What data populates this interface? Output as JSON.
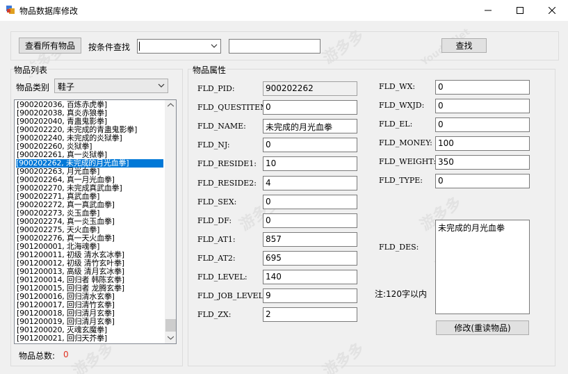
{
  "window": {
    "title": "物品数据库修改"
  },
  "toolbar": {
    "view_all_label": "查看所有物品",
    "condition_label": "按条件查找",
    "condition_value": "",
    "search_value": "",
    "search_label": "查找"
  },
  "item_list": {
    "title": "物品列表",
    "category_label": "物品类别",
    "category_value": "鞋子",
    "items": [
      "[900202036, 百炼赤虎拳]",
      "[900202038, 真炎赤狼拳]",
      "[900202040, 青蛊鬼影拳]",
      "[900202220, 未完成的青蛊鬼影拳]",
      "[900202240, 未完成的炎狱拳]",
      "[900202260, 炎狱拳]",
      "[900202261, 真一炎狱拳]",
      "[900202262, 未完成的月光血拳]",
      "[900202263, 月光血拳]",
      "[900202264, 真一月光血拳]",
      "[900202270, 未完成真武血拳]",
      "[900202271, 真武血拳]",
      "[900202272, 真一真武血拳]",
      "[900202273, 炎玉血拳]",
      "[900202274, 真一炎玉血拳]",
      "[900202275, 天火血拳]",
      "[900202276, 真一天火血拳]",
      "[901200001, 北海魂拳]",
      "[901200011, 初级 清水玄冰拳]",
      "[901200012, 初级 清竹玄叶拳]",
      "[901200013, 高级 清月玄冰拳]",
      "[901200014, 回归者 韩陈玄拳]",
      "[901200015, 回归者 龙腾玄拳]",
      "[901200016, 回归清水玄拳]",
      "[901200017, 回归清竹玄拳]",
      "[901200018, 回归清月玄拳]",
      "[901200019, 回归清月玄拳]",
      "[901200020, 灭魂玄魔拳]",
      "[901200021, 回归天芥拳]"
    ],
    "selected_index": 7,
    "total_label": "物品总数:",
    "total_value": "0"
  },
  "attributes": {
    "title": "物品属性",
    "left_fields": [
      {
        "label": "FLD_PID:",
        "value": "900202262"
      },
      {
        "label": "FLD_QUESTITEM:",
        "value": "0"
      },
      {
        "label": "FLD_NAME:",
        "value": "未完成的月光血拳"
      },
      {
        "label": "FLD_NJ:",
        "value": "0"
      },
      {
        "label": "FLD_RESIDE1:",
        "value": "10"
      },
      {
        "label": "FLD_RESIDE2:",
        "value": "4"
      },
      {
        "label": "FLD_SEX:",
        "value": "0"
      },
      {
        "label": "FLD_DF:",
        "value": "0"
      },
      {
        "label": "FLD_AT1:",
        "value": "857"
      },
      {
        "label": "FLD_AT2:",
        "value": "695"
      },
      {
        "label": "FLD_LEVEL:",
        "value": "140"
      },
      {
        "label": "FLD_JOB_LEVEL:",
        "value": "9"
      },
      {
        "label": "FLD_ZX:",
        "value": "2"
      }
    ],
    "right_fields": [
      {
        "label": "FLD_WX:",
        "value": "0"
      },
      {
        "label": "FLD_WXJD:",
        "value": "0"
      },
      {
        "label": "FLD_EL:",
        "value": "0"
      },
      {
        "label": "FLD_MONEY:",
        "value": "100"
      },
      {
        "label": "FLD_WEIGHT:",
        "value": "350"
      },
      {
        "label": "FLD_TYPE:",
        "value": "0"
      }
    ],
    "des_label": "FLD_DES:",
    "des_value": "未完成的月光血拳",
    "note": "注:120字以内",
    "modify_label": "修改(重读物品)"
  },
  "watermark": {
    "cn": "游多多",
    "en": "Youdd.Net"
  }
}
